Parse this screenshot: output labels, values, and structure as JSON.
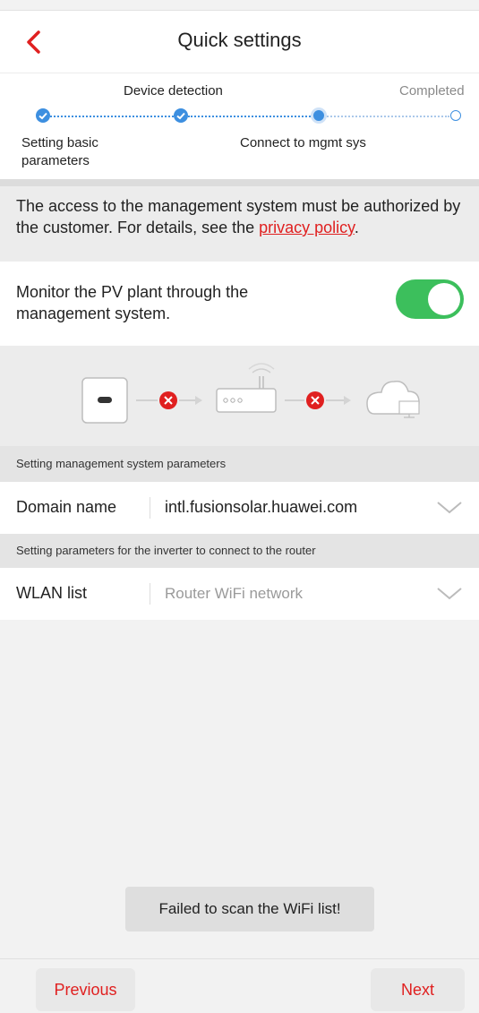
{
  "header": {
    "title": "Quick settings",
    "back_icon": "chevron-left-icon"
  },
  "steps": [
    {
      "label": "Setting basic parameters",
      "status": "done"
    },
    {
      "label": "Device detection",
      "status": "done"
    },
    {
      "label": "Connect to mgmt sys",
      "status": "current"
    },
    {
      "label": "Completed",
      "status": "pending"
    }
  ],
  "notice": {
    "text": "The access to the management system must be authorized by the customer. For details, see the ",
    "link": "privacy policy",
    "suffix": "."
  },
  "monitor": {
    "text": "Monitor the PV plant through the management system.",
    "enabled": true
  },
  "diagram": {
    "nodes": [
      "inverter-icon",
      "router-icon",
      "cloud-icon"
    ],
    "status": "disconnected"
  },
  "management_section": {
    "header": "Setting management system parameters",
    "domain_label": "Domain name",
    "domain_value": "intl.fusionsolar.huawei.com"
  },
  "router_section": {
    "header": "Setting parameters for the inverter to connect to the router",
    "wlan_label": "WLAN list",
    "wlan_placeholder": "Router WiFi network"
  },
  "toast": "Failed to scan the WiFi list!",
  "footer": {
    "previous": "Previous",
    "next": "Next"
  },
  "colors": {
    "accent": "#e02020",
    "toggle_on": "#3cbf5c",
    "step_blue": "#3d8fe0"
  }
}
